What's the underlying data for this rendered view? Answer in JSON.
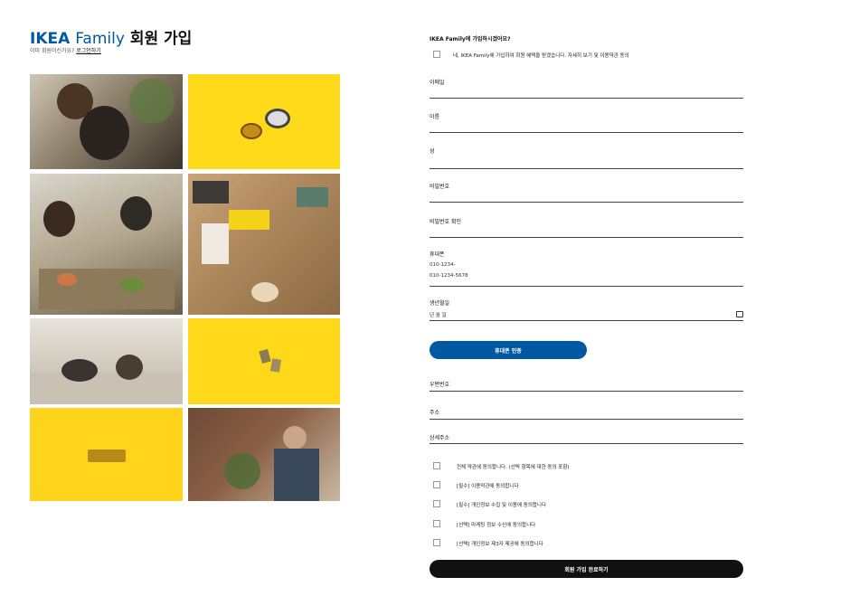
{
  "header": {
    "title_part1": "IKEA",
    "title_part2": "Family",
    "title_part3": "회원 가입",
    "subtitle_text": "이미 회원이신가요?",
    "subtitle_link": "로그인하기"
  },
  "form": {
    "question": "IKEA Family에 가입하시겠어요?",
    "join_checkbox_label": "네, IKEA Family에 가입하여 회원 혜택을 받겠습니다. 자세히 보기 및 이용약관 동의",
    "fields": [
      {
        "label": "이메일",
        "value": ""
      },
      {
        "label": "이름",
        "value": ""
      },
      {
        "label": "성",
        "value": ""
      },
      {
        "label": "비밀번호",
        "value": ""
      },
      {
        "label": "비밀번호 확인",
        "value": ""
      },
      {
        "label": "휴대폰",
        "value": "010-1234-",
        "value2": "010-1234-5678"
      },
      {
        "label": "생년월일",
        "value": "년  월  일"
      }
    ],
    "verify_button": "휴대폰 인증",
    "address_fields": [
      {
        "label": "우편번호"
      },
      {
        "label": "주소"
      },
      {
        "label": "상세주소"
      }
    ],
    "consents": [
      "전체 약관에 동의합니다. (선택 항목에 대한 동의 포함)",
      "[필수] 이용약관에 동의합니다",
      "[필수] 개인정보 수집 및 이용에 동의합니다",
      "[선택] 마케팅 정보 수신에 동의합니다",
      "[선택] 개인정보 제3자 제공에 동의합니다"
    ],
    "submit_button": "회원 가입 완료하기"
  },
  "colors": {
    "brand_blue": "#0058a3",
    "yellow": "#ffda1a",
    "submit_black": "#111111"
  }
}
